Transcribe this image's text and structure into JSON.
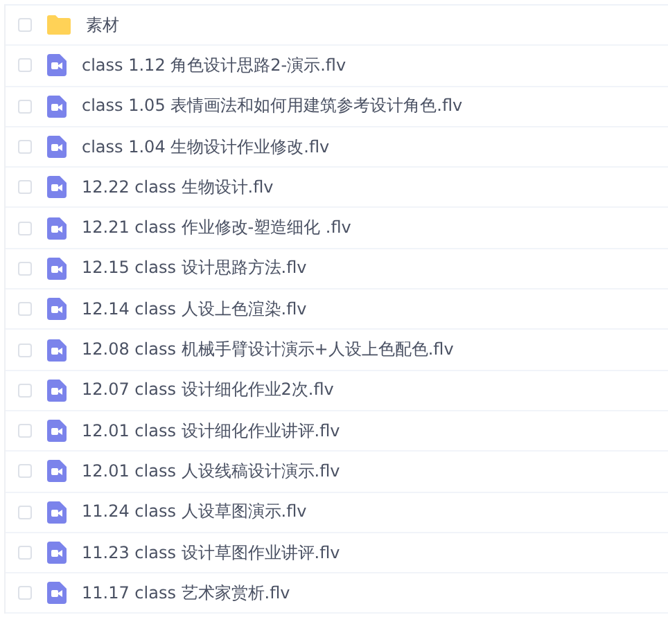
{
  "files": [
    {
      "kind": "folder",
      "name": "素材",
      "checked": false
    },
    {
      "kind": "video",
      "name": "class 1.12 角色设计思路2-演示.flv",
      "checked": false
    },
    {
      "kind": "video",
      "name": "class 1.05 表情画法和如何用建筑参考设计角色.flv",
      "checked": false
    },
    {
      "kind": "video",
      "name": "class 1.04 生物设计作业修改.flv",
      "checked": false
    },
    {
      "kind": "video",
      "name": "12.22 class 生物设计.flv",
      "checked": false
    },
    {
      "kind": "video",
      "name": "12.21 class 作业修改-塑造细化 .flv",
      "checked": false
    },
    {
      "kind": "video",
      "name": "12.15 class 设计思路方法.flv",
      "checked": false
    },
    {
      "kind": "video",
      "name": "12.14 class 人设上色渲染.flv",
      "checked": false
    },
    {
      "kind": "video",
      "name": "12.08 class 机械手臂设计演示+人设上色配色.flv",
      "checked": false
    },
    {
      "kind": "video",
      "name": "12.07 class 设计细化作业2次.flv",
      "checked": false
    },
    {
      "kind": "video",
      "name": "12.01 class 设计细化作业讲评.flv",
      "checked": false
    },
    {
      "kind": "video",
      "name": "12.01 class 人设线稿设计演示.flv",
      "checked": false
    },
    {
      "kind": "video",
      "name": "11.24 class 人设草图演示.flv",
      "checked": false
    },
    {
      "kind": "video",
      "name": "11.23 class 设计草图作业讲评.flv",
      "checked": false
    },
    {
      "kind": "video",
      "name": "11.17 class 艺术家赏析.flv",
      "checked": false
    }
  ]
}
